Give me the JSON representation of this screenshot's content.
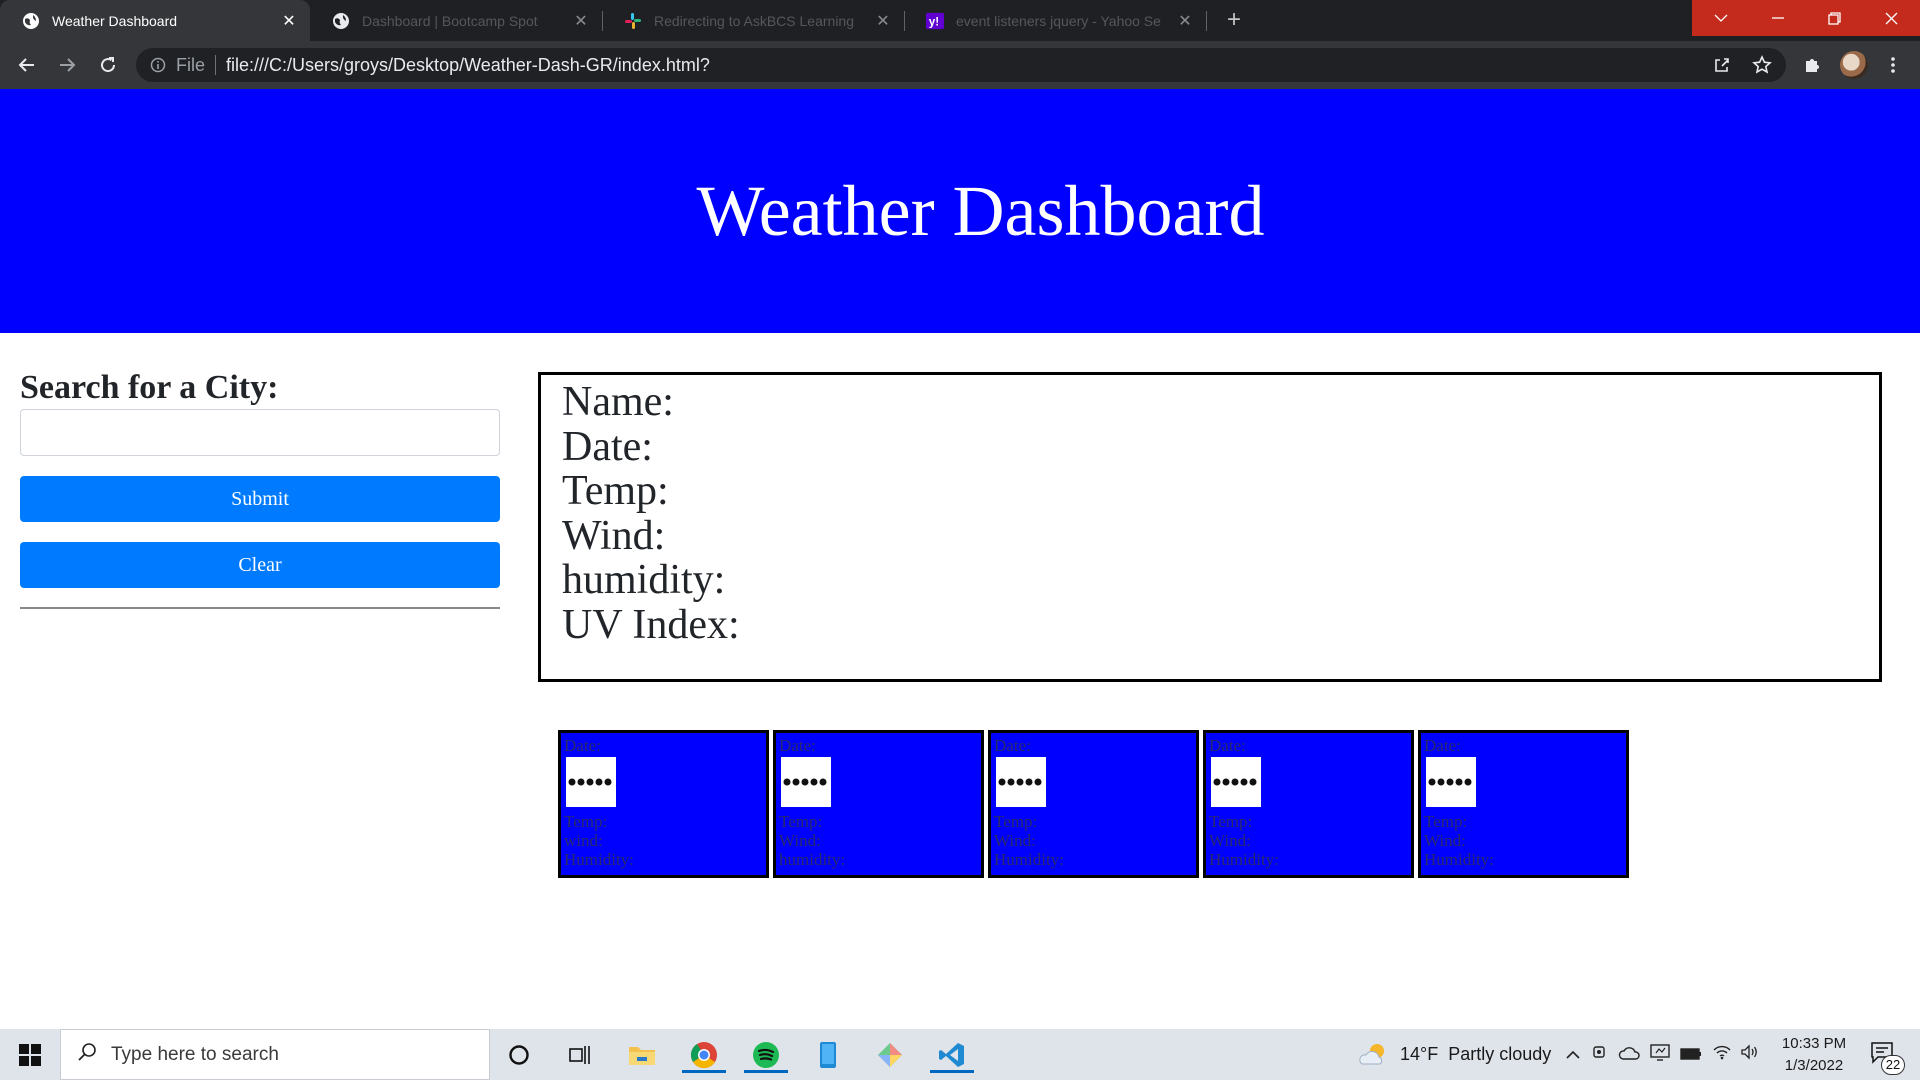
{
  "browser": {
    "tabs": [
      {
        "title": "Weather Dashboard",
        "icon": "globe-icon",
        "active": true
      },
      {
        "title": "Dashboard | Bootcamp Spot",
        "icon": "globe-icon",
        "active": false
      },
      {
        "title": "Redirecting to AskBCS Learning",
        "icon": "slack-icon",
        "active": false
      },
      {
        "title": "event listeners jquery - Yahoo Se",
        "icon": "yahoo-icon",
        "active": false
      }
    ],
    "close_glyph": "✕",
    "new_tab_glyph": "+",
    "address": {
      "scheme_label": "File",
      "url": "file:///C:/Users/groys/Desktop/Weather-Dash-GR/index.html?"
    }
  },
  "page": {
    "title": "Weather Dashboard",
    "search": {
      "heading": "Search for a City:",
      "value": "",
      "placeholder": ""
    },
    "buttons": {
      "submit": "Submit",
      "clear": "Clear"
    },
    "current": {
      "labels": [
        "Name:",
        "Date:",
        "Temp:",
        "Wind:",
        "humidity:",
        "UV Index:"
      ]
    },
    "forecast": [
      {
        "date": "Date:",
        "icon_text": "•••••",
        "temp": "Temp:",
        "wind": "wind:",
        "humidity": "Humidity:"
      },
      {
        "date": "Date:",
        "icon_text": "•••••",
        "temp": "Temp:",
        "wind": "Wind:",
        "humidity": "humidity:"
      },
      {
        "date": "Date:",
        "icon_text": "•••••",
        "temp": "Temp:",
        "wind": "Wind:",
        "humidity": "Humidity:"
      },
      {
        "date": "Date:",
        "icon_text": "•••••",
        "temp": "Temp:",
        "wind": "Wind:",
        "humidity": "Humidity:"
      },
      {
        "date": "Date:",
        "icon_text": "•••••",
        "temp": "Temp:",
        "wind": "Wind:",
        "humidity": "Humidity:"
      }
    ]
  },
  "taskbar": {
    "search_placeholder": "Type here to search",
    "weather": {
      "temp": "14°F",
      "condition": "Partly cloudy"
    },
    "time": "10:33 PM",
    "date": "1/3/2022",
    "notifications": "22"
  },
  "colors": {
    "hero": "#0000ff",
    "button": "#007bff",
    "forecast_card": "#0000ff"
  }
}
